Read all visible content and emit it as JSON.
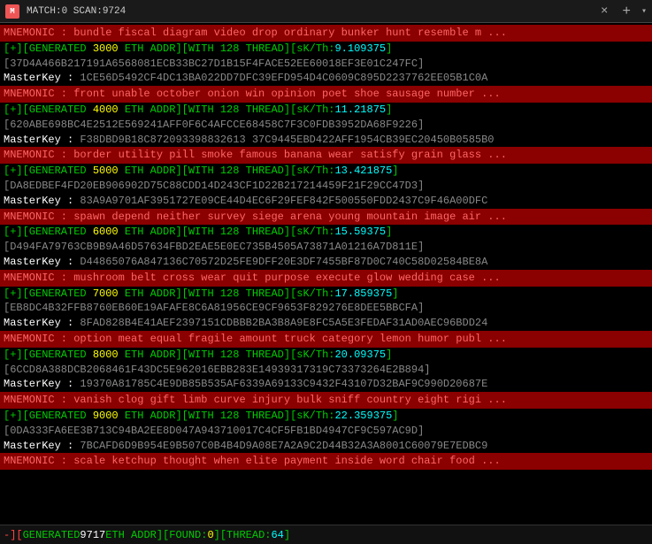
{
  "titleBar": {
    "icon": "M",
    "text": "MATCH:0 SCAN:9724",
    "close": "×",
    "add": "+",
    "dropdown": "▾"
  },
  "statusBar": {
    "prefix": "-][",
    "generated_label": " GENERATED ",
    "generated_val": "9717",
    "eth_addr": " ETH ADDR ",
    "found_label": "][FOUND:",
    "found_val": "0",
    "thread_label": "][THREAD:",
    "thread_val": "64",
    "suffix": "]"
  },
  "lines": [
    {
      "type": "mnemonic",
      "text": "MNEMONIC : bundle fiscal diagram video drop ordinary bunker hunt resemble m ..."
    },
    {
      "type": "generated",
      "pre": "[+][GENERATED ",
      "genval": "3000",
      "mid1": " ETH ADDR][WITH ",
      "mid2": "128",
      "mid3": " THREAD][sK/Th:",
      "skval": "9.109375",
      "post": "]"
    },
    {
      "type": "hash",
      "text": "[37D4A466B217191A6568081ECB33BC27D1B15F4FACE52EE60018EF3E01C247FC]"
    },
    {
      "type": "masterkey",
      "label": "MasterKey : ",
      "text": "1CE56D5492CF4DC13BA022DD7DFC39EFD954D4C0609C895D2237762EE05B1C0A"
    },
    {
      "type": "mnemonic",
      "text": "MNEMONIC : front unable october onion win opinion poet shoe sausage number ..."
    },
    {
      "type": "generated",
      "pre": "[+][GENERATED ",
      "genval": "4000",
      "mid1": " ETH ADDR][WITH ",
      "mid2": "128",
      "mid3": " THREAD][sK/Th:",
      "skval": "11.21875",
      "post": "]"
    },
    {
      "type": "hash",
      "text": "[620ABE698BC4E2512E569241AFF0F6C4AFCCE68458C7F3C0FDB3952DA68F9226]"
    },
    {
      "type": "masterkey",
      "label": "MasterKey : ",
      "text": "F38DBD9B18C872093398832613 37C9445EBD422AFF1954CB39EC20450B0585B0"
    },
    {
      "type": "mnemonic",
      "text": "MNEMONIC : border utility pill smoke famous banana wear satisfy grain glass ..."
    },
    {
      "type": "generated",
      "pre": "[+][GENERATED ",
      "genval": "5000",
      "mid1": " ETH ADDR][WITH ",
      "mid2": "128",
      "mid3": " THREAD][sK/Th:",
      "skval": "13.421875",
      "post": "]"
    },
    {
      "type": "hash",
      "text": "[DA8EDBEF4FD20EB906902D75C88CDD14D243CF1D22B217214459F21F29CC47D3]"
    },
    {
      "type": "masterkey",
      "label": "MasterKey : ",
      "text": "83A9A9701AF3951727E09CE44D4EC6F29FEF842F500550FDD2437C9F46A00DFC"
    },
    {
      "type": "mnemonic",
      "text": "MNEMONIC : spawn depend neither survey siege arena young mountain image air ..."
    },
    {
      "type": "generated",
      "pre": "[+][GENERATED ",
      "genval": "6000",
      "mid1": " ETH ADDR][WITH ",
      "mid2": "128",
      "mid3": " THREAD][sK/Th:",
      "skval": "15.59375",
      "post": "]"
    },
    {
      "type": "hash",
      "text": "[D494FA79763CB9B9A46D57634FBD2EAE5E0EC735B4505A73871A01216A7D811E]"
    },
    {
      "type": "masterkey",
      "label": "MasterKey : ",
      "text": "D44865076A847136C70572D25FE9DFF20E3DF7455BF87D0C740C58D02584BE8A"
    },
    {
      "type": "mnemonic",
      "text": "MNEMONIC : mushroom belt cross wear quit purpose execute glow wedding case ..."
    },
    {
      "type": "generated",
      "pre": "[+][GENERATED ",
      "genval": "7000",
      "mid1": " ETH ADDR][WITH ",
      "mid2": "128",
      "mid3": " THREAD][sK/Th:",
      "skval": "17.859375",
      "post": "]"
    },
    {
      "type": "hash",
      "text": "[EB8DC4B32FFB8760EB60E19AFAFE8C6A81956CE9CF9653F829276E8DEE5BBCFA]"
    },
    {
      "type": "masterkey",
      "label": "MasterKey : ",
      "text": "8FAD828B4E41AEF2397151CDBBB2BA3B8A9E8FC5A5E3FEDAF31AD0AEC96BDD24"
    },
    {
      "type": "mnemonic",
      "text": "MNEMONIC : option meat equal fragile amount truck category lemon humor publ ..."
    },
    {
      "type": "generated",
      "pre": "[+][GENERATED ",
      "genval": "8000",
      "mid1": " ETH ADDR][WITH ",
      "mid2": "128",
      "mid3": " THREAD][sK/Th:",
      "skval": "20.09375",
      "post": "]"
    },
    {
      "type": "hash",
      "text": "[6CCD8A388DCB2068461F43DC5E962016EBB283E14939317319C73373264E2B894]"
    },
    {
      "type": "masterkey",
      "label": "MasterKey : ",
      "text": "19370A81785C4E9DB85B535AF6339A69133C9432F43107D32BAF9C990D20687E"
    },
    {
      "type": "mnemonic",
      "text": "MNEMONIC : vanish clog gift limb curve injury bulk sniff country eight rigi ..."
    },
    {
      "type": "generated",
      "pre": "[+][GENERATED ",
      "genval": "9000",
      "mid1": " ETH ADDR][WITH ",
      "mid2": "128",
      "mid3": " THREAD][sK/Th:",
      "skval": "22.359375",
      "post": "]"
    },
    {
      "type": "hash",
      "text": "[0DA333FA6EE3B713C94BA2EE8D047A943710017C4CF5FB1BD4947CF9C597AC9D]"
    },
    {
      "type": "masterkey",
      "label": "MasterKey : ",
      "text": "7BCAFD6D9B954E9B507C0B4B4D9A08E7A2A9C2D44B32A3A8001C60079E7EDBC9"
    },
    {
      "type": "mnemonic",
      "text": "MNEMONIC : scale ketchup thought when elite payment inside word chair food ..."
    }
  ]
}
